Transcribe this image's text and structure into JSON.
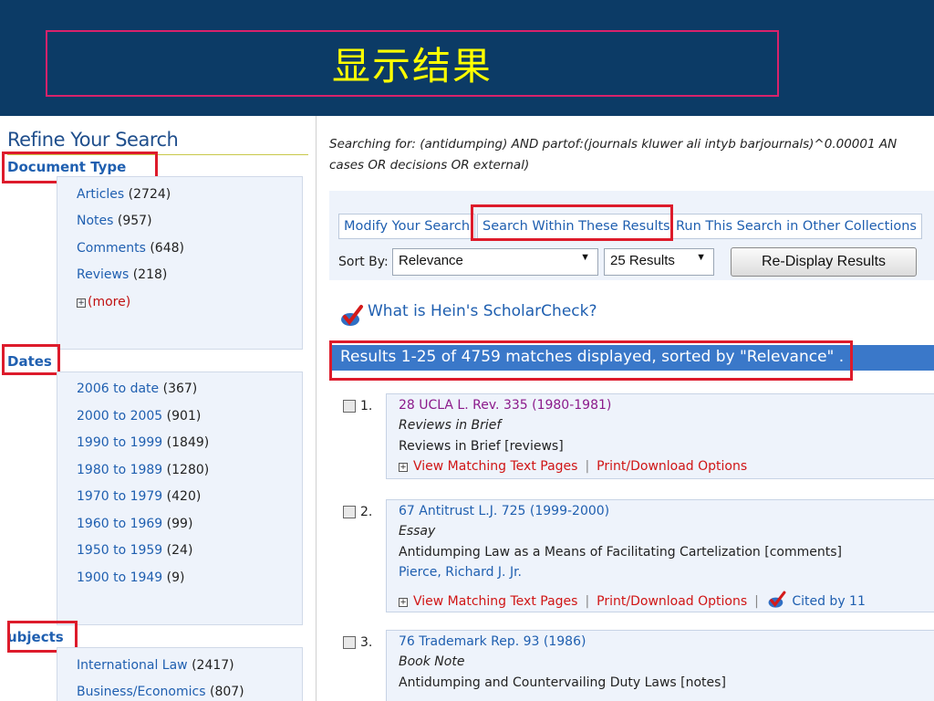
{
  "slide": {
    "title": "显示结果"
  },
  "sidebar": {
    "title": "Refine Your Search",
    "document_type": {
      "heading": "Document Type",
      "items": [
        {
          "label": "Articles",
          "count": "(2724)"
        },
        {
          "label": "Notes",
          "count": "(957)"
        },
        {
          "label": "Comments",
          "count": "(648)"
        },
        {
          "label": "Reviews",
          "count": "(218)"
        }
      ],
      "more": "(more)"
    },
    "dates": {
      "heading": "Dates",
      "items": [
        {
          "label": "2006 to date",
          "count": "(367)"
        },
        {
          "label": "2000 to 2005",
          "count": "(901)"
        },
        {
          "label": "1990 to 1999",
          "count": "(1849)"
        },
        {
          "label": "1980 to 1989",
          "count": "(1280)"
        },
        {
          "label": "1970 to 1979",
          "count": "(420)"
        },
        {
          "label": "1960 to 1969",
          "count": "(99)"
        },
        {
          "label": "1950 to 1959",
          "count": "(24)"
        },
        {
          "label": "1900 to 1949",
          "count": "(9)"
        }
      ]
    },
    "subjects": {
      "heading": "ubjects",
      "items": [
        {
          "label": "International Law",
          "count": "(2417)"
        },
        {
          "label": "Business/Economics",
          "count": "(807)"
        }
      ]
    }
  },
  "search": {
    "line1": "Searching for: (antidumping) AND partof:(journals kluwer ali intyb barjournals)^0.00001 AN",
    "line2": "cases OR decisions OR external)"
  },
  "toolbar": {
    "modify": "Modify Your Search",
    "within": "Search Within These Results",
    "other": "Run This Search in Other Collections",
    "sort_label": "Sort By:",
    "sort_value": "Relevance",
    "count_value": "25 Results",
    "redisplay": "Re-Display Results"
  },
  "scholarcheck": "What is Hein's ScholarCheck?",
  "results_summary": "Results 1-25 of 4759 matches displayed, sorted by \"Relevance\" .",
  "results": [
    {
      "num": "1.",
      "citation": "28 UCLA L. Rev. 335 (1980-1981)",
      "type": "Reviews in Brief",
      "title": "Reviews in Brief [reviews]",
      "author": "",
      "view": "View Matching Text Pages",
      "print": "Print/Download Options",
      "cited": ""
    },
    {
      "num": "2.",
      "citation": "67 Antitrust L.J. 725 (1999-2000)",
      "type": "Essay",
      "title": "Antidumping Law as a Means of Facilitating Cartelization [comments]",
      "author": "Pierce, Richard J. Jr.",
      "view": "View Matching Text Pages",
      "print": "Print/Download Options",
      "cited": "Cited by 11"
    },
    {
      "num": "3.",
      "citation": "76 Trademark Rep. 93 (1986)",
      "type": "Book Note",
      "title": "Antidumping and Countervailing Duty Laws [notes]",
      "author": "",
      "view": "",
      "print": "",
      "cited": ""
    }
  ],
  "colors": {
    "slide_bg": "#0c3b66",
    "title": "#ffff00",
    "highlight_box": "#dd1b2b",
    "link": "#1f5fb0",
    "result_bar": "#3a78c9"
  }
}
